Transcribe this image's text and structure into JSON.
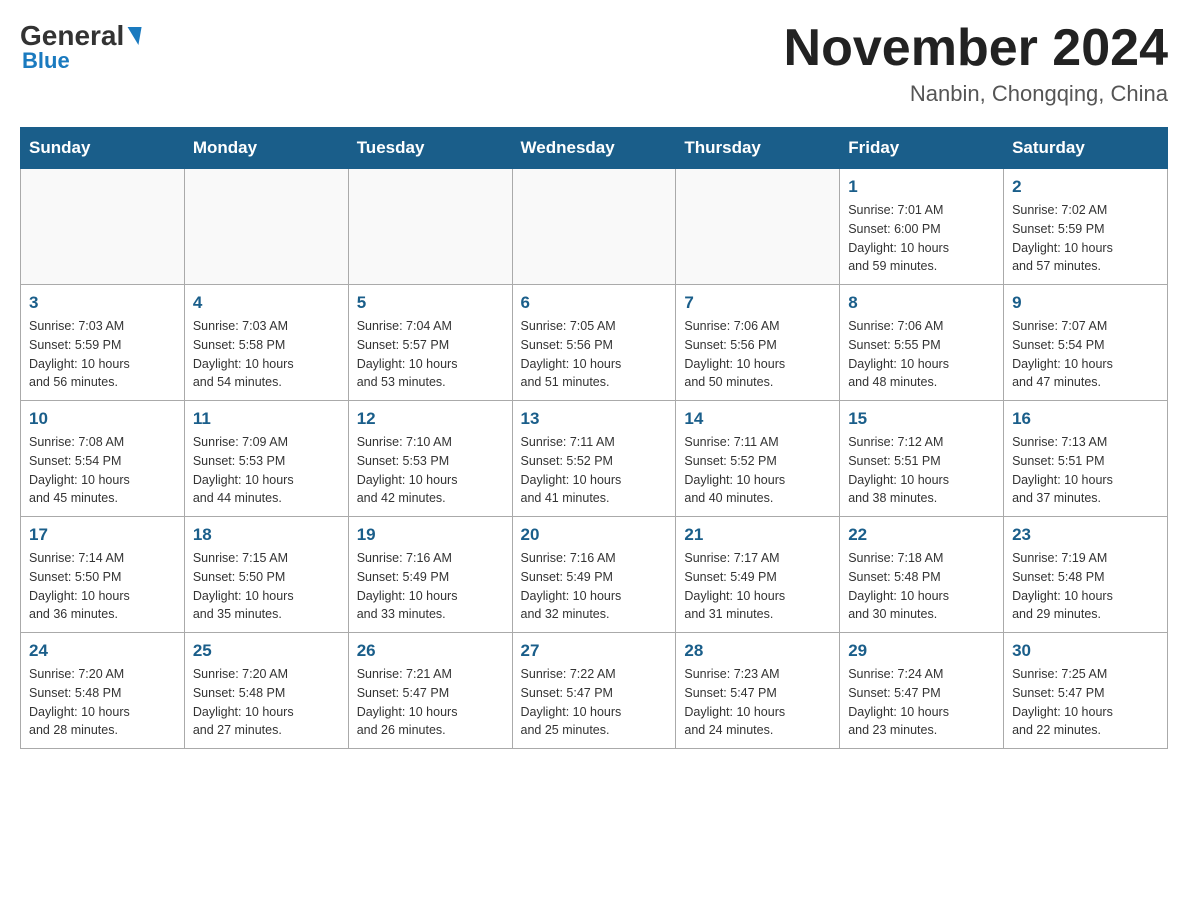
{
  "header": {
    "logo_general": "General",
    "logo_blue": "Blue",
    "month_title": "November 2024",
    "location": "Nanbin, Chongqing, China"
  },
  "weekdays": [
    "Sunday",
    "Monday",
    "Tuesday",
    "Wednesday",
    "Thursday",
    "Friday",
    "Saturday"
  ],
  "weeks": [
    [
      {
        "day": "",
        "info": ""
      },
      {
        "day": "",
        "info": ""
      },
      {
        "day": "",
        "info": ""
      },
      {
        "day": "",
        "info": ""
      },
      {
        "day": "",
        "info": ""
      },
      {
        "day": "1",
        "info": "Sunrise: 7:01 AM\nSunset: 6:00 PM\nDaylight: 10 hours\nand 59 minutes."
      },
      {
        "day": "2",
        "info": "Sunrise: 7:02 AM\nSunset: 5:59 PM\nDaylight: 10 hours\nand 57 minutes."
      }
    ],
    [
      {
        "day": "3",
        "info": "Sunrise: 7:03 AM\nSunset: 5:59 PM\nDaylight: 10 hours\nand 56 minutes."
      },
      {
        "day": "4",
        "info": "Sunrise: 7:03 AM\nSunset: 5:58 PM\nDaylight: 10 hours\nand 54 minutes."
      },
      {
        "day": "5",
        "info": "Sunrise: 7:04 AM\nSunset: 5:57 PM\nDaylight: 10 hours\nand 53 minutes."
      },
      {
        "day": "6",
        "info": "Sunrise: 7:05 AM\nSunset: 5:56 PM\nDaylight: 10 hours\nand 51 minutes."
      },
      {
        "day": "7",
        "info": "Sunrise: 7:06 AM\nSunset: 5:56 PM\nDaylight: 10 hours\nand 50 minutes."
      },
      {
        "day": "8",
        "info": "Sunrise: 7:06 AM\nSunset: 5:55 PM\nDaylight: 10 hours\nand 48 minutes."
      },
      {
        "day": "9",
        "info": "Sunrise: 7:07 AM\nSunset: 5:54 PM\nDaylight: 10 hours\nand 47 minutes."
      }
    ],
    [
      {
        "day": "10",
        "info": "Sunrise: 7:08 AM\nSunset: 5:54 PM\nDaylight: 10 hours\nand 45 minutes."
      },
      {
        "day": "11",
        "info": "Sunrise: 7:09 AM\nSunset: 5:53 PM\nDaylight: 10 hours\nand 44 minutes."
      },
      {
        "day": "12",
        "info": "Sunrise: 7:10 AM\nSunset: 5:53 PM\nDaylight: 10 hours\nand 42 minutes."
      },
      {
        "day": "13",
        "info": "Sunrise: 7:11 AM\nSunset: 5:52 PM\nDaylight: 10 hours\nand 41 minutes."
      },
      {
        "day": "14",
        "info": "Sunrise: 7:11 AM\nSunset: 5:52 PM\nDaylight: 10 hours\nand 40 minutes."
      },
      {
        "day": "15",
        "info": "Sunrise: 7:12 AM\nSunset: 5:51 PM\nDaylight: 10 hours\nand 38 minutes."
      },
      {
        "day": "16",
        "info": "Sunrise: 7:13 AM\nSunset: 5:51 PM\nDaylight: 10 hours\nand 37 minutes."
      }
    ],
    [
      {
        "day": "17",
        "info": "Sunrise: 7:14 AM\nSunset: 5:50 PM\nDaylight: 10 hours\nand 36 minutes."
      },
      {
        "day": "18",
        "info": "Sunrise: 7:15 AM\nSunset: 5:50 PM\nDaylight: 10 hours\nand 35 minutes."
      },
      {
        "day": "19",
        "info": "Sunrise: 7:16 AM\nSunset: 5:49 PM\nDaylight: 10 hours\nand 33 minutes."
      },
      {
        "day": "20",
        "info": "Sunrise: 7:16 AM\nSunset: 5:49 PM\nDaylight: 10 hours\nand 32 minutes."
      },
      {
        "day": "21",
        "info": "Sunrise: 7:17 AM\nSunset: 5:49 PM\nDaylight: 10 hours\nand 31 minutes."
      },
      {
        "day": "22",
        "info": "Sunrise: 7:18 AM\nSunset: 5:48 PM\nDaylight: 10 hours\nand 30 minutes."
      },
      {
        "day": "23",
        "info": "Sunrise: 7:19 AM\nSunset: 5:48 PM\nDaylight: 10 hours\nand 29 minutes."
      }
    ],
    [
      {
        "day": "24",
        "info": "Sunrise: 7:20 AM\nSunset: 5:48 PM\nDaylight: 10 hours\nand 28 minutes."
      },
      {
        "day": "25",
        "info": "Sunrise: 7:20 AM\nSunset: 5:48 PM\nDaylight: 10 hours\nand 27 minutes."
      },
      {
        "day": "26",
        "info": "Sunrise: 7:21 AM\nSunset: 5:47 PM\nDaylight: 10 hours\nand 26 minutes."
      },
      {
        "day": "27",
        "info": "Sunrise: 7:22 AM\nSunset: 5:47 PM\nDaylight: 10 hours\nand 25 minutes."
      },
      {
        "day": "28",
        "info": "Sunrise: 7:23 AM\nSunset: 5:47 PM\nDaylight: 10 hours\nand 24 minutes."
      },
      {
        "day": "29",
        "info": "Sunrise: 7:24 AM\nSunset: 5:47 PM\nDaylight: 10 hours\nand 23 minutes."
      },
      {
        "day": "30",
        "info": "Sunrise: 7:25 AM\nSunset: 5:47 PM\nDaylight: 10 hours\nand 22 minutes."
      }
    ]
  ]
}
